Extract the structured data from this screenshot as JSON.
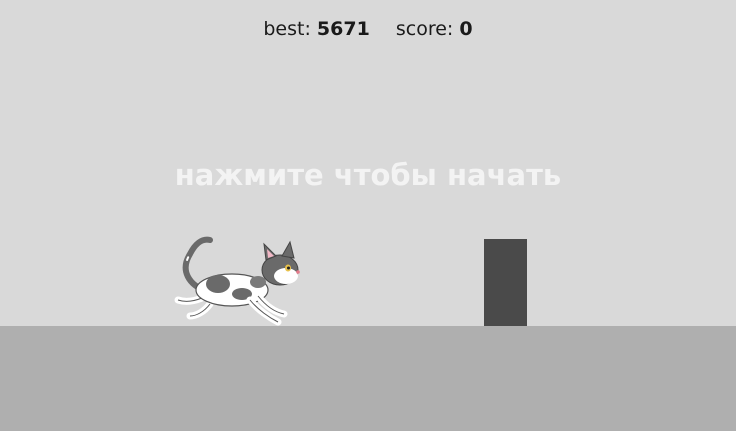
{
  "hud": {
    "best_label": "best:",
    "best_value": "5671",
    "score_label": "score:",
    "score_value": "0"
  },
  "overlay": {
    "message": "нажмите чтобы начать"
  },
  "colors": {
    "sky": "#d9d9d9",
    "ground": "#afafaf",
    "obstacle": "#4a4a4a",
    "message": "#f3f3f3"
  },
  "sprites": {
    "player": "running-cat",
    "obstacle": "block"
  }
}
